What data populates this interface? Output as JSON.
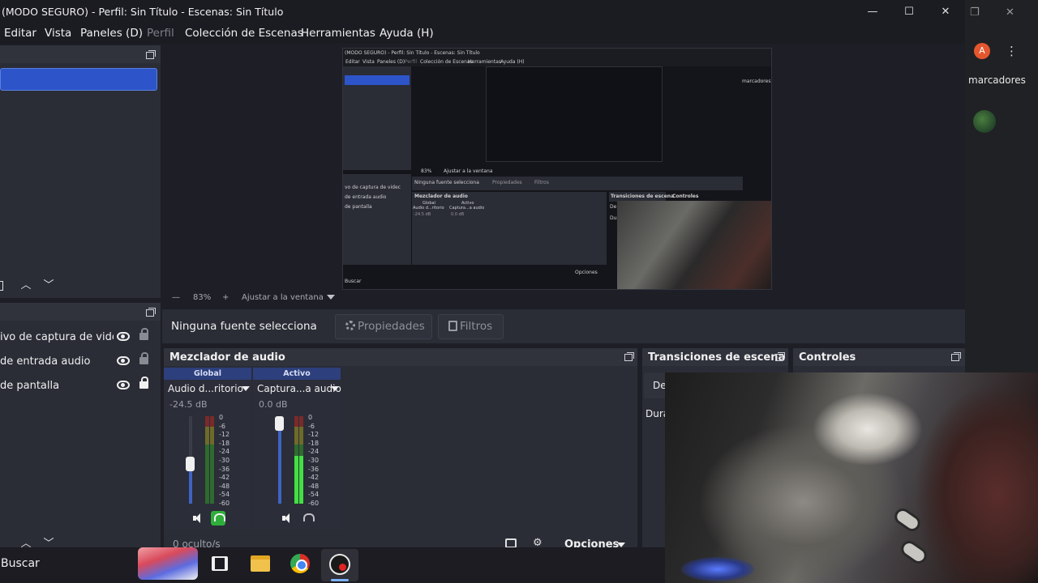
{
  "window": {
    "title": "(MODO SEGURO) - Perfil: Sin Título - Escenas: Sin Título",
    "minimize": "—",
    "maximize": "☐",
    "close": "✕"
  },
  "menu": {
    "items": [
      "Editar",
      "Vista",
      "Paneles (D)",
      "Perfil",
      "Colección de Escenas",
      "Herramientas",
      "Ayuda (H)"
    ]
  },
  "sources": {
    "items": [
      {
        "label": "ivo de captura de videc"
      },
      {
        "label": "de entrada audio"
      },
      {
        "label": "de pantalla"
      }
    ]
  },
  "preview": {
    "zoom_minus": "—",
    "zoom_value": "83%",
    "zoom_plus": "+",
    "fit_label": "Ajustar a la ventana",
    "nested": {
      "title": "(MODO SEGURO) - Perfil: Sin Título - Escenas: Sin Título",
      "menu": [
        "Editar",
        "Vista",
        "Paneles (D)",
        "Perfil",
        "Colección de Escenas",
        "Herramientas",
        "Ayuda (H)"
      ],
      "sources": [
        "vo de captura de videc",
        "de entrada audio",
        "de pantalla"
      ],
      "no_source": "Ninguna fuente selecciona",
      "properties": "Propiedades",
      "filters": "Filtros",
      "mixer_title": "Mezclador de audio",
      "transitions_title": "Transiciones de escena",
      "controls_title": "Controles",
      "badge_global": "Global",
      "badge_active": "Activo",
      "ch1": "Audio d...ritorio",
      "ch2": "Captura...a audio",
      "db1": "-24.5 dB",
      "db2": "0.0 dB",
      "bookmarks": "marcadores",
      "search": "Buscar",
      "zoom": "83%",
      "fit": "Ajustar a la ventana",
      "options": "Opciones",
      "trans_de": "De",
      "trans_dur": "Dur"
    }
  },
  "properties_bar": {
    "no_source": "Ninguna fuente selecciona",
    "properties_label": "Propiedades",
    "filters_label": "Filtros"
  },
  "mixer": {
    "title": "Mezclador de audio",
    "channels": [
      {
        "badge": "Global",
        "name": "Audio d...ritorio",
        "db": "-24.5 dB",
        "fader_level": 0.45,
        "meter_level": 0.0
      },
      {
        "badge": "Activo",
        "name": "Captura...a audio",
        "db": "0.0 dB",
        "fader_level": 1.0,
        "meter_level": 0.55
      }
    ],
    "scale": [
      "0",
      "-6",
      "-12",
      "-18",
      "-24",
      "-30",
      "-36",
      "-42",
      "-48",
      "-54",
      "-60"
    ],
    "footer_hidden": "0 oculto/s",
    "options_label": "Opciones"
  },
  "transitions": {
    "title": "Transiciones de escena",
    "row1": "De",
    "row2": "Dura"
  },
  "controls": {
    "title": "Controles"
  },
  "chrome": {
    "avatar_letter": "A",
    "bookmarks": "marcadores",
    "kebab": "⋮",
    "restore": "❐",
    "close": "✕"
  },
  "taskbar": {
    "search_label": "Buscar"
  },
  "colors": {
    "accent": "#2d55c9",
    "panel": "#2a2c36",
    "background": "#1e1f26",
    "meter_green": "#43e043",
    "monitor_active": "#2fae3b"
  }
}
